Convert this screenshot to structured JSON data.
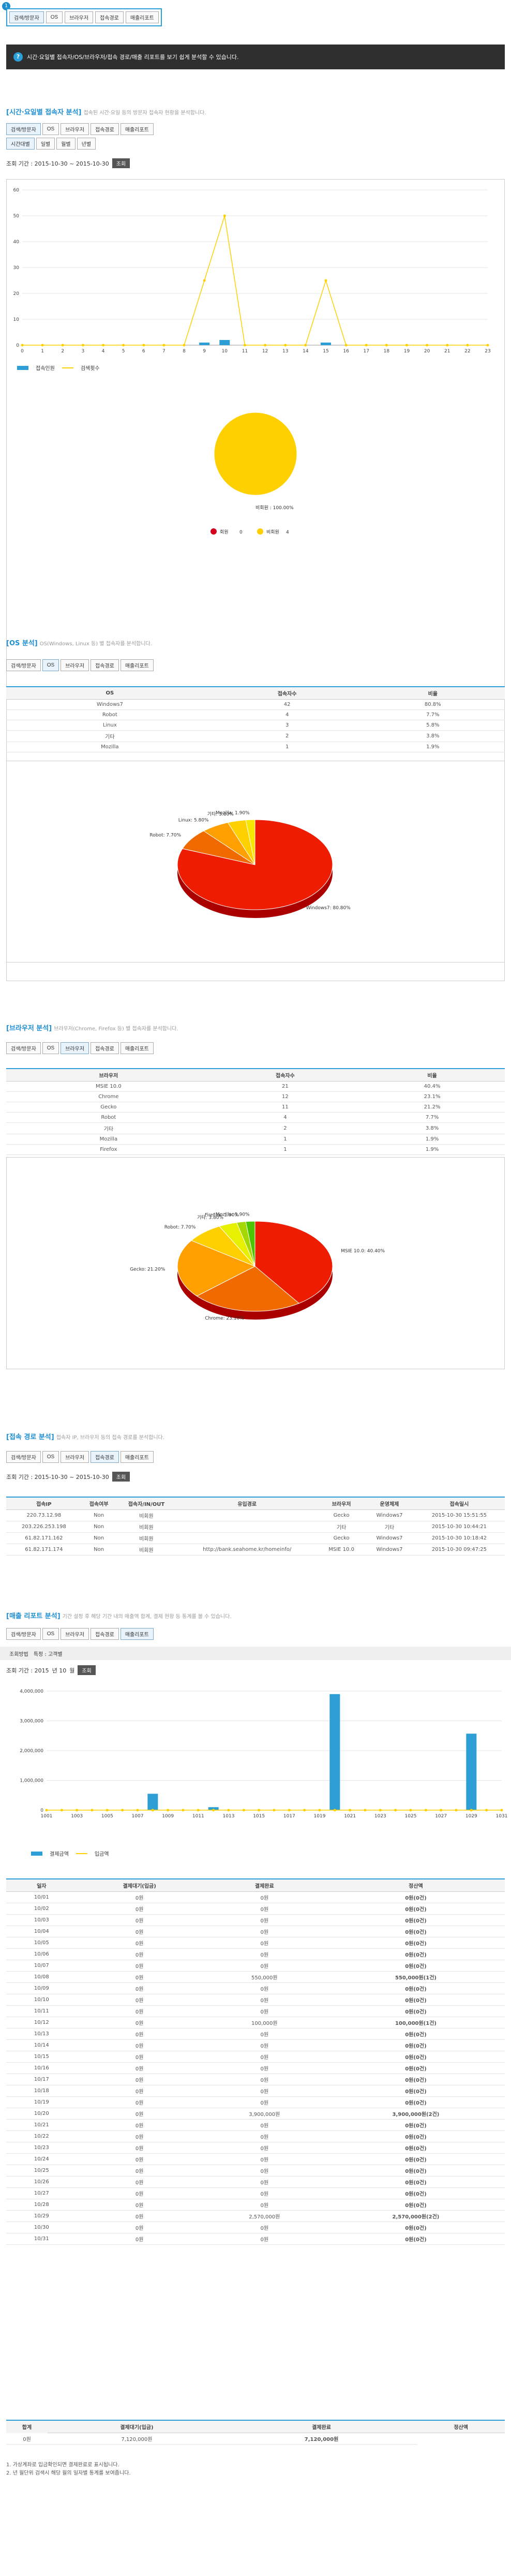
{
  "tabs": [
    "검색/방문자",
    "OS",
    "브라우저",
    "접속경로",
    "매출리포트"
  ],
  "badge": "1",
  "notice": "시간·요일별 접속자/OS/브라우저/접속 경로/매출 리포트를 보기 쉽게 분석할 수 있습니다.",
  "hourly": {
    "title": "[시간·요일별 접속자 분석]",
    "desc": "접속된 시간·요일 등의 방문자 접속자 현황을 분석합니다.",
    "sub_tabs": [
      "시간대별",
      "일별",
      "월별",
      "년별"
    ],
    "period_label": "조회 기간 : 2015-10-30 ~ 2015-10-30",
    "go": "조회",
    "legend_bar": "접속인원",
    "legend_line": "검색횟수"
  },
  "chart_hourly": {
    "type": "bar",
    "categories": [
      "0",
      "1",
      "2",
      "3",
      "4",
      "5",
      "6",
      "7",
      "8",
      "9",
      "10",
      "11",
      "12",
      "13",
      "14",
      "15",
      "16",
      "17",
      "18",
      "19",
      "20",
      "21",
      "22",
      "23"
    ],
    "series": [
      {
        "name": "접속인원",
        "values": [
          0,
          0,
          0,
          0,
          0,
          0,
          0,
          0,
          0,
          1,
          2,
          0,
          0,
          0,
          0,
          1,
          0,
          0,
          0,
          0,
          0,
          0,
          0,
          0
        ]
      },
      {
        "name": "검색횟수",
        "values": [
          0,
          0,
          0,
          0,
          0,
          0,
          0,
          0,
          0,
          25,
          50,
          0,
          0,
          0,
          0,
          25,
          0,
          0,
          0,
          0,
          0,
          0,
          0,
          0
        ]
      }
    ],
    "yticks": [
      "0",
      "10",
      "20",
      "30",
      "40",
      "50",
      "60"
    ],
    "ylim": [
      0,
      60
    ]
  },
  "chart_pie1": {
    "type": "pie",
    "slices": [
      {
        "label": "비회원",
        "value": 100,
        "color": "#ffd000"
      }
    ],
    "slice_label": "비회원 : 100.00%",
    "legend": [
      {
        "label": "회원",
        "count": "0",
        "color": "#d6001c"
      },
      {
        "label": "비회원",
        "count": "4",
        "color": "#ffd000"
      }
    ]
  },
  "os": {
    "title": "[OS 분석]",
    "desc": "OS(Windows, Linux 등) 별 접속자를 분석합니다.",
    "headers": [
      "OS",
      "접속자수",
      "비율"
    ],
    "rows": [
      [
        "Windows7",
        "42",
        "80.8%"
      ],
      [
        "Robot",
        "4",
        "7.7%"
      ],
      [
        "Linux",
        "3",
        "5.8%"
      ],
      [
        "기타",
        "2",
        "3.8%"
      ],
      [
        "Mozilla",
        "1",
        "1.9%"
      ]
    ]
  },
  "chart_os": {
    "type": "pie",
    "slices": [
      {
        "label": "Windows7: 80.80%",
        "value": 80.8,
        "color": "#ee1c00"
      },
      {
        "label": "Robot: 7.70%",
        "value": 7.7,
        "color": "#f06a00"
      },
      {
        "label": "Linux: 5.80%",
        "value": 5.8,
        "color": "#ffa000"
      },
      {
        "label": "기타: 3.80%",
        "value": 3.8,
        "color": "#ffd000"
      },
      {
        "label": "Mozilla: 1.90%",
        "value": 1.9,
        "color": "#f6e600"
      }
    ]
  },
  "browser": {
    "title": "[브라우저 분석]",
    "desc": "브라우저(Chrome, Firefox 등) 별 접속자를 분석합니다.",
    "headers": [
      "브라우저",
      "접속자수",
      "비율"
    ],
    "rows": [
      [
        "MSIE 10.0",
        "21",
        "40.4%"
      ],
      [
        "Chrome",
        "12",
        "23.1%"
      ],
      [
        "Gecko",
        "11",
        "21.2%"
      ],
      [
        "Robot",
        "4",
        "7.7%"
      ],
      [
        "기타",
        "2",
        "3.8%"
      ],
      [
        "Mozilla",
        "1",
        "1.9%"
      ],
      [
        "Firefox",
        "1",
        "1.9%"
      ]
    ]
  },
  "chart_browser": {
    "type": "pie",
    "slices": [
      {
        "label": "MSIE 10.0: 40.40%",
        "value": 40.4,
        "color": "#ee1c00"
      },
      {
        "label": "Chrome: 23.10%",
        "value": 23.1,
        "color": "#f06a00"
      },
      {
        "label": "Gecko: 21.20%",
        "value": 21.2,
        "color": "#ffa000"
      },
      {
        "label": "Robot: 7.70%",
        "value": 7.7,
        "color": "#ffd000"
      },
      {
        "label": "기타: 3.80%",
        "value": 3.8,
        "color": "#e6f000"
      },
      {
        "label": "FireFox: 1.90%",
        "value": 1.9,
        "color": "#a4d800"
      },
      {
        "label": "Mozilla: 1.90%",
        "value": 1.9,
        "color": "#4cc400"
      }
    ]
  },
  "referer": {
    "title": "[접속 경로 분석]",
    "desc": "접속자 IP, 브라우저 등의 접속 경로를 분석합니다.",
    "period_label": "조회 기간 : 2015-10-30 ~ 2015-10-30",
    "go": "조회",
    "headers": [
      "접속IP",
      "접속여부",
      "접속자/IN/OUT",
      "유입경로",
      "브라우저",
      "운영체제",
      "접속일시"
    ],
    "rows": [
      [
        "220.73.12.98",
        "Non",
        "비회원",
        "",
        "Gecko",
        "Windows7",
        "2015-10-30 15:51:55"
      ],
      [
        "203.226.253.198",
        "Non",
        "비회원",
        "",
        "기타",
        "기타",
        "2015-10-30 10:44:21"
      ],
      [
        "61.82.171.162",
        "Non",
        "비회원",
        "",
        "Gecko",
        "Windows7",
        "2015-10-30 10:18:42"
      ],
      [
        "61.82.171.174",
        "Non",
        "비회원",
        "http://bank.seahome.kr/homeinfo/",
        "MSIE 10.0",
        "Windows7",
        "2015-10-30 09:47:25"
      ]
    ]
  },
  "sales": {
    "title": "[매출 리포트 분석]",
    "desc": "기간 설정 후 해당 기간 내의 매출액 합계, 결제 현황 등 통계를 볼 수 있습니다.",
    "filter_label": "조회방법",
    "filter_value": "특정 : 고객별",
    "period_label": "조회 기간 : 2015",
    "period_mid": "년 10",
    "period_end": "월",
    "go": "조회",
    "legend_bar": "결제금액",
    "legend_line": "입금액",
    "headers": [
      "일자",
      "결제대기(입금)",
      "결제완료",
      "정산액"
    ],
    "rows": [
      [
        "10/01",
        "0원",
        "0원",
        "0원(0건)"
      ],
      [
        "10/02",
        "0원",
        "0원",
        "0원(0건)"
      ],
      [
        "10/03",
        "0원",
        "0원",
        "0원(0건)"
      ],
      [
        "10/04",
        "0원",
        "0원",
        "0원(0건)"
      ],
      [
        "10/05",
        "0원",
        "0원",
        "0원(0건)"
      ],
      [
        "10/06",
        "0원",
        "0원",
        "0원(0건)"
      ],
      [
        "10/07",
        "0원",
        "0원",
        "0원(0건)"
      ],
      [
        "10/08",
        "0원",
        "550,000원",
        "550,000원(1건)"
      ],
      [
        "10/09",
        "0원",
        "0원",
        "0원(0건)"
      ],
      [
        "10/10",
        "0원",
        "0원",
        "0원(0건)"
      ],
      [
        "10/11",
        "0원",
        "0원",
        "0원(0건)"
      ],
      [
        "10/12",
        "0원",
        "100,000원",
        "100,000원(1건)"
      ],
      [
        "10/13",
        "0원",
        "0원",
        "0원(0건)"
      ],
      [
        "10/14",
        "0원",
        "0원",
        "0원(0건)"
      ],
      [
        "10/15",
        "0원",
        "0원",
        "0원(0건)"
      ],
      [
        "10/16",
        "0원",
        "0원",
        "0원(0건)"
      ],
      [
        "10/17",
        "0원",
        "0원",
        "0원(0건)"
      ],
      [
        "10/18",
        "0원",
        "0원",
        "0원(0건)"
      ],
      [
        "10/19",
        "0원",
        "0원",
        "0원(0건)"
      ],
      [
        "10/20",
        "0원",
        "3,900,000원",
        "3,900,000원(2건)"
      ],
      [
        "10/21",
        "0원",
        "0원",
        "0원(0건)"
      ],
      [
        "10/22",
        "0원",
        "0원",
        "0원(0건)"
      ],
      [
        "10/23",
        "0원",
        "0원",
        "0원(0건)"
      ],
      [
        "10/24",
        "0원",
        "0원",
        "0원(0건)"
      ],
      [
        "10/25",
        "0원",
        "0원",
        "0원(0건)"
      ],
      [
        "10/26",
        "0원",
        "0원",
        "0원(0건)"
      ],
      [
        "10/27",
        "0원",
        "0원",
        "0원(0건)"
      ],
      [
        "10/28",
        "0원",
        "0원",
        "0원(0건)"
      ],
      [
        "10/29",
        "0원",
        "2,570,000원",
        "2,570,000원(2건)"
      ],
      [
        "10/30",
        "0원",
        "0원",
        "0원(0건)"
      ],
      [
        "10/31",
        "0원",
        "0원",
        "0원(0건)"
      ]
    ],
    "total_label": "합계",
    "total_headers": [
      "결제대기(입금)",
      "결제완료",
      "정산액"
    ],
    "total_values": [
      "0원",
      "7,120,000원",
      "7,120,000원"
    ],
    "notes": [
      "1. 가상계좌로 입금확인되면 결제완료로 표시됩니다.",
      "2. 년 월단위 검색시 해당 월의 일자별 통계를 보여줍니다."
    ]
  },
  "chart_sales": {
    "type": "bar",
    "categories": [
      "1001",
      "1002",
      "1003",
      "1004",
      "1005",
      "1006",
      "1007",
      "1008",
      "1009",
      "1010",
      "1011",
      "1012",
      "1013",
      "1014",
      "1015",
      "1016",
      "1017",
      "1018",
      "1019",
      "1020",
      "1021",
      "1022",
      "1023",
      "1024",
      "1025",
      "1026",
      "1027",
      "1028",
      "1029",
      "1030",
      "1031"
    ],
    "series": [
      {
        "name": "결제금액",
        "values": [
          0,
          0,
          0,
          0,
          0,
          0,
          0,
          550000,
          0,
          0,
          0,
          100000,
          0,
          0,
          0,
          0,
          0,
          0,
          0,
          3900000,
          0,
          0,
          0,
          0,
          0,
          0,
          0,
          0,
          2570000,
          0,
          0
        ]
      },
      {
        "name": "입금액",
        "values": [
          0,
          0,
          0,
          0,
          0,
          0,
          0,
          0,
          0,
          0,
          0,
          0,
          0,
          0,
          0,
          0,
          0,
          0,
          0,
          0,
          0,
          0,
          0,
          0,
          0,
          0,
          0,
          0,
          0,
          0,
          0
        ]
      }
    ],
    "xticks": [
      "1001",
      "1003",
      "1005",
      "1007",
      "1009",
      "1011",
      "1013",
      "1015",
      "1017",
      "1019",
      "1021",
      "1023",
      "1025",
      "1027",
      "1029",
      "1031"
    ],
    "yticks": [
      "0",
      "1,000,000",
      "2,000,000",
      "3,000,000",
      "4,000,000"
    ],
    "ylim": [
      0,
      4000000
    ]
  }
}
